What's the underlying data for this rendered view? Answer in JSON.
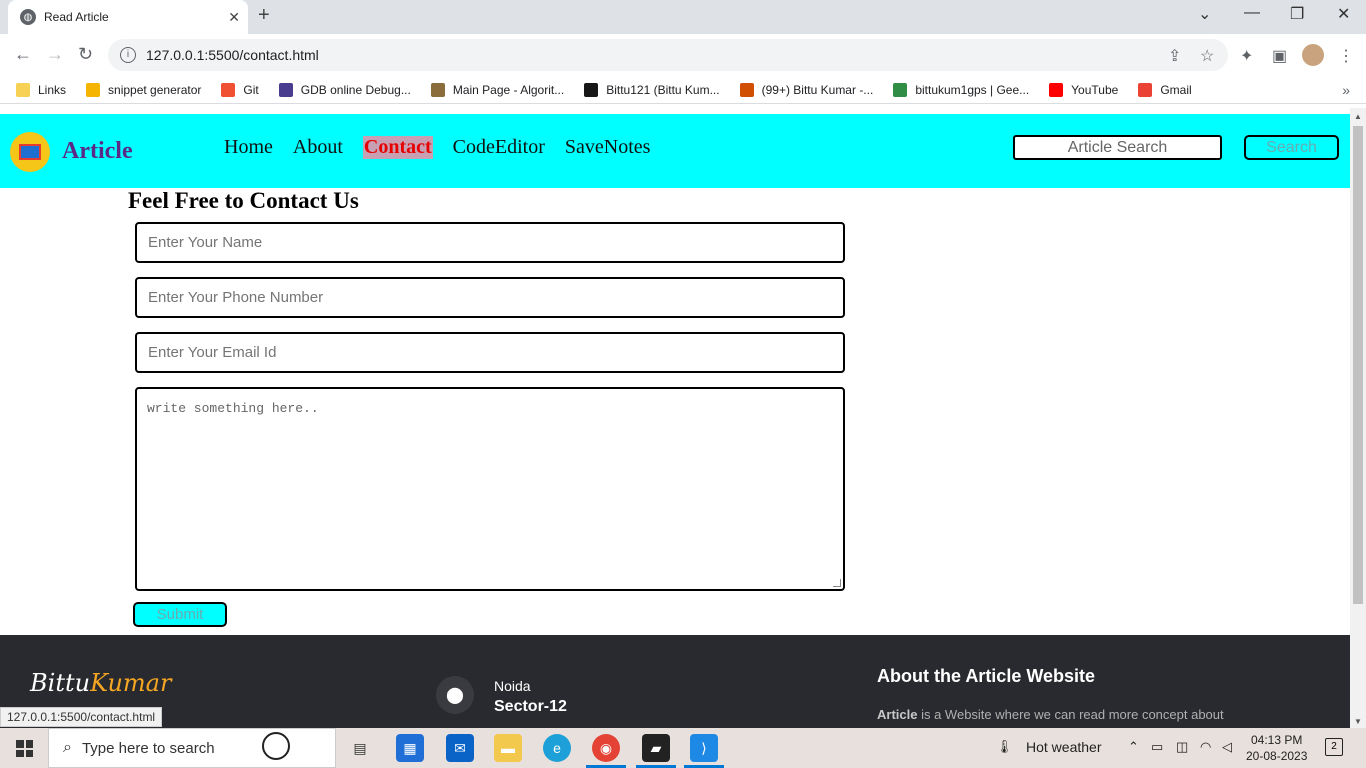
{
  "browser": {
    "tab_title": "Read Article",
    "url": "127.0.0.1:5500/contact.html",
    "bookmarks": [
      {
        "label": "Links",
        "color": "#f7d154"
      },
      {
        "label": "snippet generator",
        "color": "#f5b400"
      },
      {
        "label": "Git",
        "color": "#f05133"
      },
      {
        "label": "GDB online Debug...",
        "color": "#4a3d8f"
      },
      {
        "label": "Main Page - Algorit...",
        "color": "#8a6d3b"
      },
      {
        "label": "Bittu121 (Bittu Kum...",
        "color": "#181717"
      },
      {
        "label": "(99+) Bittu Kumar -...",
        "color": "#d04f00"
      },
      {
        "label": "bittukum1gps | Gee...",
        "color": "#2f8d46"
      },
      {
        "label": "YouTube",
        "color": "#ff0000"
      },
      {
        "label": "Gmail",
        "color": "#ea4335"
      }
    ],
    "status_url": "127.0.0.1:5500/contact.html"
  },
  "site": {
    "brand": "Article",
    "nav": [
      "Home",
      "About",
      "Contact",
      "CodeEditor",
      "SaveNotes"
    ],
    "active_nav": "Contact",
    "search_placeholder": "Article Search",
    "search_button": "Search",
    "accent_color": "#00ffff"
  },
  "contact": {
    "title": "Feel Free to Contact Us",
    "name_placeholder": "Enter Your Name",
    "phone_placeholder": "Enter Your Phone Number",
    "email_placeholder": "Enter Your Email Id",
    "message_placeholder": "write something here..",
    "submit_label": "Submit"
  },
  "footer": {
    "logo_first": "Bittu",
    "logo_second": "Kumar",
    "city": "Noida",
    "sector": "Sector-12",
    "about_title": "About the Article Website",
    "about_bold": "Article",
    "about_text": " is a Website where we can read more concept about"
  },
  "taskbar": {
    "search_placeholder": "Type here to search",
    "weather": "Hot weather",
    "time": "04:13 PM",
    "date": "20-08-2023",
    "notifications": "2"
  }
}
